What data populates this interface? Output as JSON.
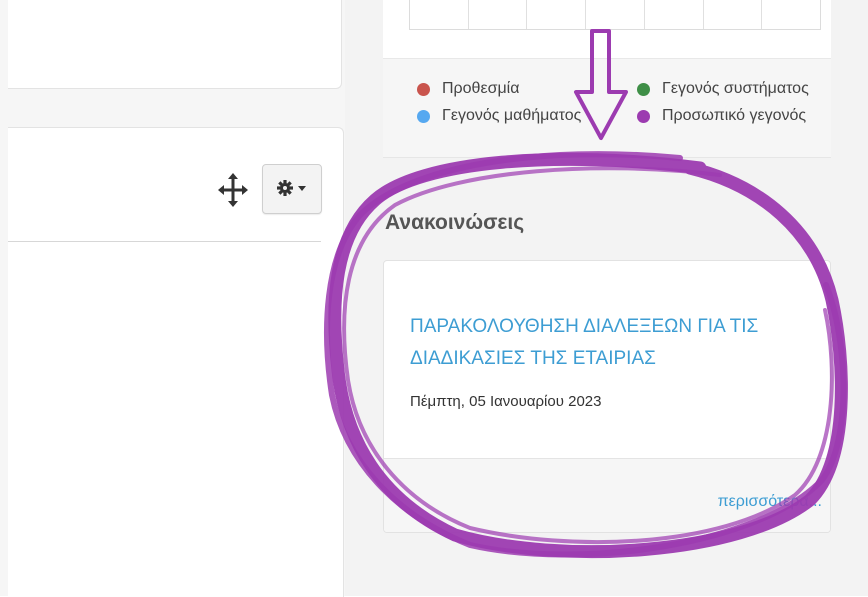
{
  "legend": [
    {
      "label": "Προθεσμία",
      "color": "#c9544d"
    },
    {
      "label": "Γεγονός συστήματος",
      "color": "#3f8f47"
    },
    {
      "label": "Γεγονός μαθήματος",
      "color": "#56a8f0"
    },
    {
      "label": "Προσωπικό γεγονός",
      "color": "#9c3bb0"
    }
  ],
  "announcements": {
    "heading": "Ανακοινώσεις",
    "title_line1": "ΠΑΡΑΚΟΛΟΥΘΗΣΗ ΔΙΑΛΕΞΕΩΝ ΓΙΑ ΤΙΣ",
    "title_line2": "ΔΙΑΔΙΚΑΣΙΕΣ ΤΗΣ ΕΤΑΙΡΙΑΣ",
    "date": "Πέμπτη, 05 Ιανουαρίου 2023",
    "more_link": "περισσότερα..."
  },
  "icons": {
    "move": "move-icon",
    "gear": "gear-icon",
    "caret": "caret-down-icon",
    "arrow_annotation": "arrow-annotation",
    "circle_annotation": "circle-annotation"
  },
  "colors": {
    "link": "#3d9dd3",
    "annotation": "#9c3bb0"
  }
}
